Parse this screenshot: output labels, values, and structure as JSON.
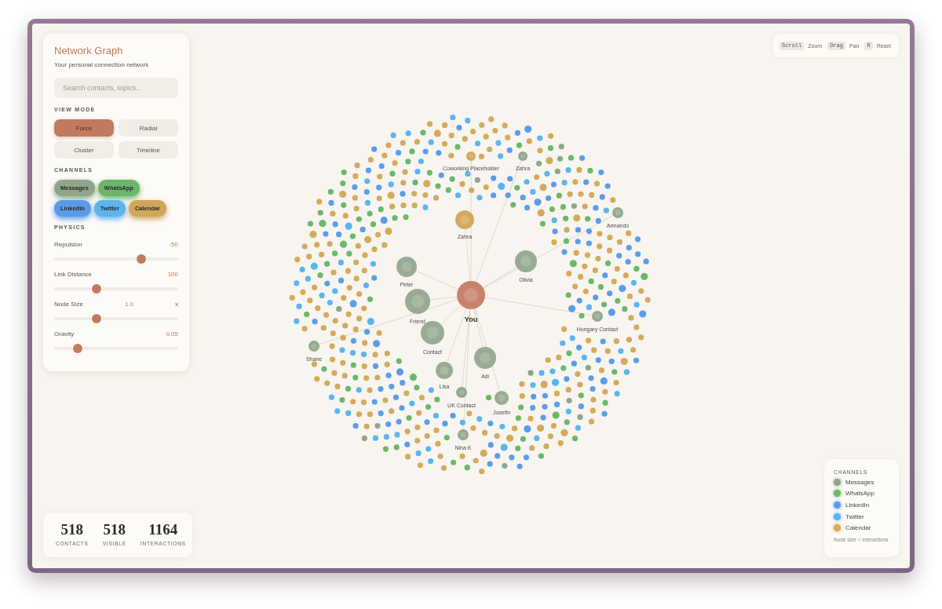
{
  "sidebar": {
    "title": "Network Graph",
    "subtitle": "Your personal connection network",
    "search": {
      "placeholder": "Search contacts, topics..."
    },
    "view_mode": {
      "heading": "VIEW MODE",
      "options": [
        {
          "label": "Force",
          "selected": true
        },
        {
          "label": "Radial",
          "selected": false
        },
        {
          "label": "Cluster",
          "selected": false
        },
        {
          "label": "Timeline",
          "selected": false
        }
      ]
    },
    "channels": {
      "heading": "CHANNELS",
      "items": [
        {
          "label": "Messages",
          "color": "#8fa68a",
          "on": true
        },
        {
          "label": "WhatsApp",
          "color": "#6cb56a",
          "on": true
        },
        {
          "label": "LinkedIn",
          "color": "#5a9be6",
          "on": true
        },
        {
          "label": "Twitter",
          "color": "#5cb3ee",
          "on": true
        },
        {
          "label": "Calendar",
          "color": "#cfa65b",
          "on": true
        }
      ]
    },
    "physics": {
      "heading": "PHYSICS",
      "sliders": [
        {
          "label": "Repulsion",
          "value": "-50",
          "level": 0.7
        },
        {
          "label": "Link Distance",
          "value": "100",
          "level": 0.34
        },
        {
          "label": "Node Size",
          "value": "1.0",
          "unit": "x",
          "level": 0.34
        },
        {
          "label": "Gravity",
          "value": "0.05",
          "level": 0.19
        }
      ]
    }
  },
  "shortcuts": [
    {
      "key": "Scroll",
      "action": "Zoom"
    },
    {
      "key": "Drag",
      "action": "Pan"
    },
    {
      "key": "R",
      "action": "Reset"
    }
  ],
  "graph": {
    "nodes": [
      {
        "label": "You",
        "kind": "self",
        "color": "#c8836a"
      },
      {
        "label": "Zahra",
        "kind": "contact",
        "color": "#d4aa5c"
      },
      {
        "label": "Peter",
        "kind": "contact",
        "color": "#98ab93"
      },
      {
        "label": "Olivia",
        "kind": "contact",
        "color": "#98ab93"
      },
      {
        "label": "Friend",
        "kind": "contact",
        "color": "#98ab93"
      },
      {
        "label": "Contact",
        "kind": "contact",
        "color": "#98ab93"
      },
      {
        "label": "Lisa",
        "kind": "contact",
        "color": "#98ab93"
      },
      {
        "label": "Adi",
        "kind": "contact",
        "color": "#98ab93"
      },
      {
        "label": "UK Contact",
        "kind": "contact",
        "color": "#95a990"
      },
      {
        "label": "Josefin",
        "kind": "contact",
        "color": "#98ab93"
      },
      {
        "label": "Nina K",
        "kind": "contact",
        "color": "#95a990"
      },
      {
        "label": "Shane",
        "kind": "contact",
        "color": "#95a990"
      },
      {
        "label": "Hungary Contact",
        "kind": "contact",
        "color": "#95a990"
      },
      {
        "label": "Armando",
        "kind": "contact",
        "color": "#95a990"
      },
      {
        "label": "Coworking Placeholder",
        "kind": "contact",
        "color": "#d4aa5c"
      },
      {
        "label": "Zahra",
        "kind": "contact",
        "color": "#95a990"
      }
    ]
  },
  "legend": {
    "heading": "CHANNELS",
    "items": [
      {
        "label": "Messages",
        "color": "#8fa68a"
      },
      {
        "label": "WhatsApp",
        "color": "#6cb86a"
      },
      {
        "label": "LinkedIn",
        "color": "#5b9de9"
      },
      {
        "label": "Twitter",
        "color": "#5bb5f0"
      },
      {
        "label": "Calendar",
        "color": "#d4aa5c"
      }
    ],
    "note": "Node size = interactions"
  },
  "stats": [
    {
      "value": "518",
      "label": "CONTACTS"
    },
    {
      "value": "518",
      "label": "VISIBLE"
    },
    {
      "value": "1164",
      "label": "INTERACTIONS"
    }
  ]
}
